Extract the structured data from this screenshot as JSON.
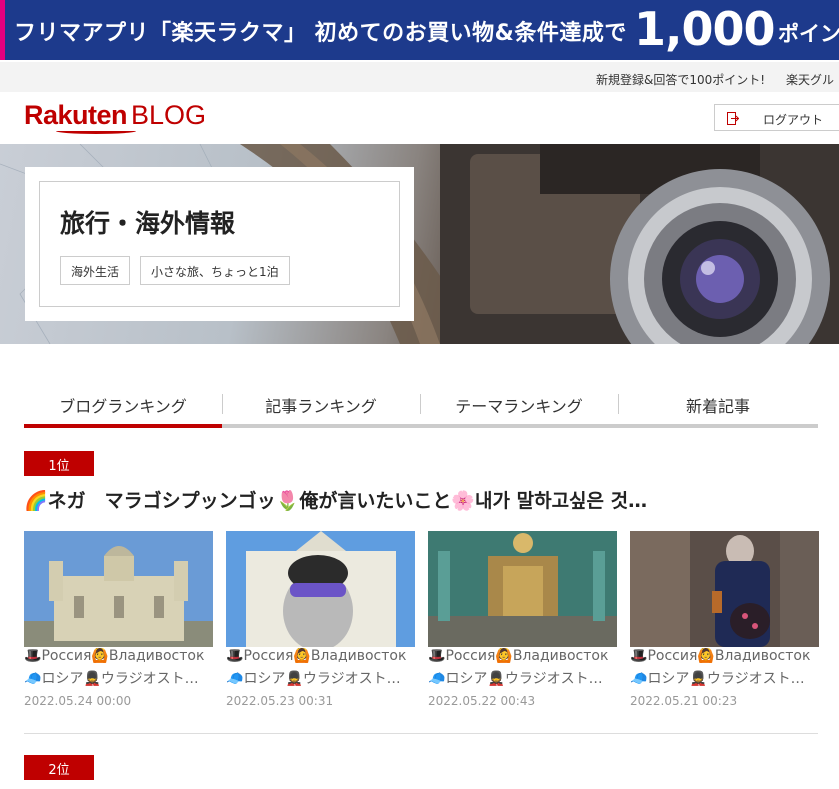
{
  "banner": {
    "text": "フリマアプリ「楽天ラクマ」 初めてのお買い物&条件達成で",
    "amount": "1,000",
    "unit": "ポイン"
  },
  "utility": {
    "links": [
      "新規登録&回答で100ポイント!",
      "楽天グル"
    ]
  },
  "header": {
    "logo_main": "Rakuten",
    "logo_sub": "BLOG",
    "logout_label": "ログアウト"
  },
  "hero": {
    "title": "旅行・海外情報",
    "tags": [
      "海外生活",
      "小さな旅、ちょっと1泊"
    ]
  },
  "tabs": [
    {
      "label": "ブログランキング",
      "active": true
    },
    {
      "label": "記事ランキング",
      "active": false
    },
    {
      "label": "テーマランキング",
      "active": false
    },
    {
      "label": "新着記事",
      "active": false
    }
  ],
  "ranking": [
    {
      "rank": "1位",
      "title": "ネガ　マラゴシプッンゴッ",
      "title_mid": "俺が言いたいこと",
      "title_end": "내가 말하고싶은 것…",
      "posts": [
        {
          "line1": "Россия",
          "line1b": "Владивосток",
          "line2": "ロシア",
          "line2b": "ウラジオスト…",
          "date": "2022.05.24 00:00"
        },
        {
          "line1": "Россия",
          "line1b": "Владивосток",
          "line2": "ロシア",
          "line2b": "ウラジオスト…",
          "date": "2022.05.23 00:31"
        },
        {
          "line1": "Россия",
          "line1b": "Владивосток",
          "line2": "ロシア",
          "line2b": "ウラジオスト…",
          "date": "2022.05.22 00:43"
        },
        {
          "line1": "Россия",
          "line1b": "Владивосток",
          "line2": "ロシア",
          "line2b": "ウラジオスト…",
          "date": "2022.05.21 00:23"
        }
      ]
    },
    {
      "rank": "2位"
    }
  ],
  "colors": {
    "brand": "#bf0000",
    "banner": "#1d3a8c"
  }
}
